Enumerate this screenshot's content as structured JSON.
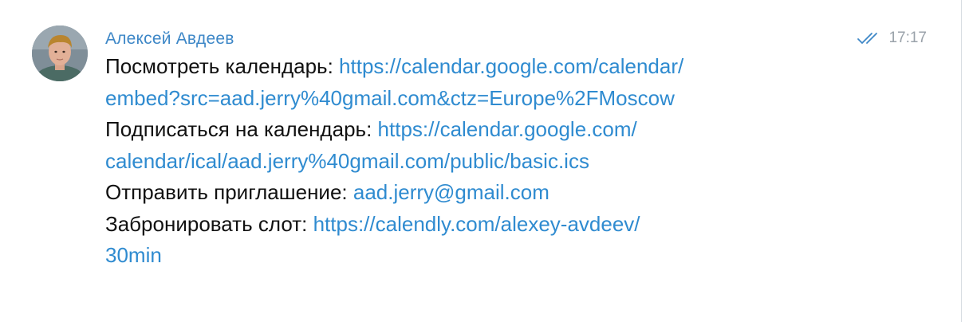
{
  "message": {
    "sender": "Алексей Авдеев",
    "time": "17:17",
    "status_icon": "double-check-icon",
    "lines": [
      {
        "label": "Посмотреть календарь: ",
        "link_part1": "https://calendar.google.com/calendar/",
        "link_part2": "embed?src=aad.jerry%40gmail.com&ctz=Europe%2FMoscow"
      },
      {
        "label": "Подписаться на календарь: ",
        "link_part1": "https://calendar.google.com/",
        "link_part2": "calendar/ical/aad.jerry%40gmail.com/public/basic.ics"
      },
      {
        "label": "Отправить приглашение: ",
        "link_part1": "aad.jerry@gmail.com"
      },
      {
        "label": "Забронировать слот: ",
        "link_part1": "https://calendly.com/alexey-avdeev/",
        "link_part2": "30min"
      }
    ]
  },
  "colors": {
    "sender": "#3d87c7",
    "link": "#2f8bd0",
    "time": "#9aa2aa",
    "check": "#3d87c7"
  }
}
